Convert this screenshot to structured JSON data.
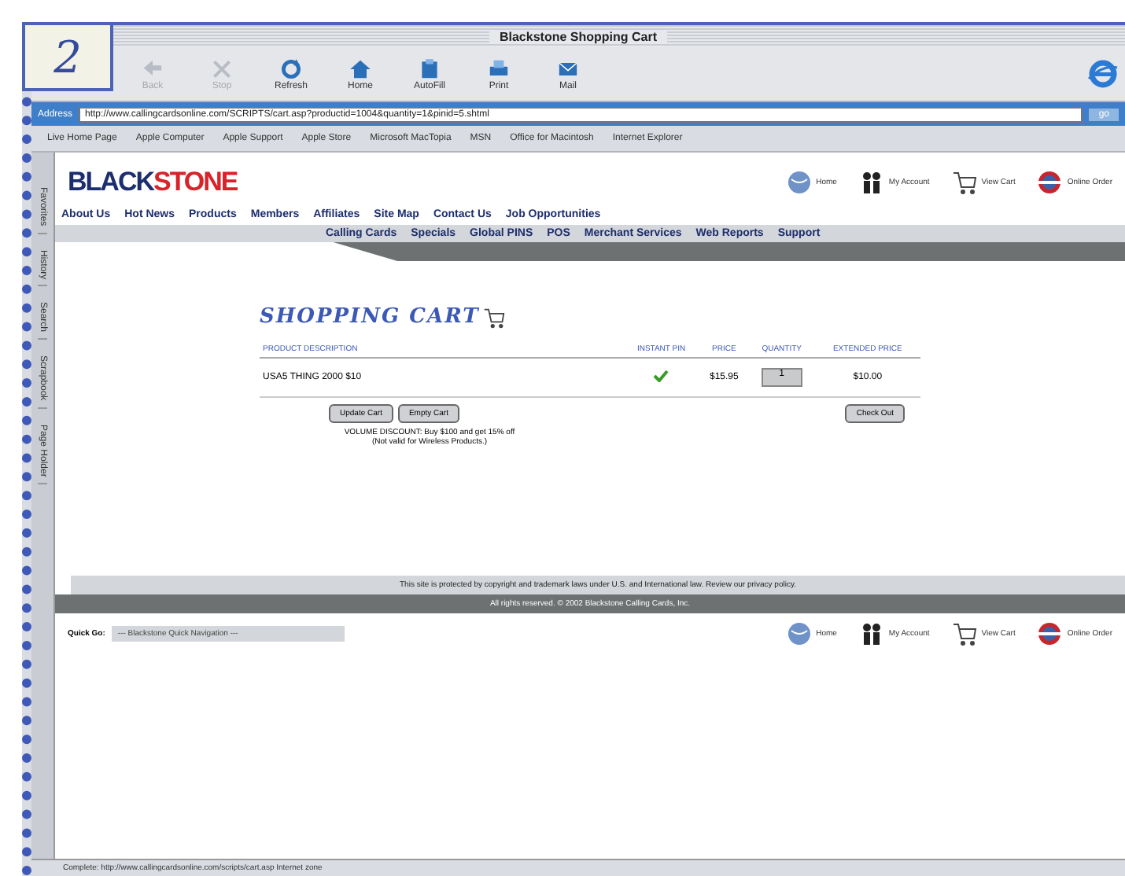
{
  "step_number": "2",
  "window": {
    "title": "Blackstone Shopping Cart"
  },
  "toolbar": [
    {
      "label": "Back",
      "disabled": true
    },
    {
      "label": "Stop",
      "disabled": true
    },
    {
      "label": "Refresh",
      "disabled": false
    },
    {
      "label": "Home",
      "disabled": false
    },
    {
      "label": "AutoFill",
      "disabled": false
    },
    {
      "label": "Print",
      "disabled": false
    },
    {
      "label": "Mail",
      "disabled": false
    }
  ],
  "address_bar": {
    "label": "Address",
    "value": "http://www.callingcardsonline.com/SCRIPTS/cart.asp?productid=1004&quantity=1&pinid=5.shtml",
    "go": "go"
  },
  "favorites_bar": [
    "Live Home Page",
    "Apple Computer",
    "Apple Support",
    "Apple Store",
    "Microsoft MacTopia",
    "MSN",
    "Office for Macintosh",
    "Internet Explorer"
  ],
  "side_tabs": [
    "Favorites",
    "History",
    "Search",
    "Scrapbook",
    "Page Holder"
  ],
  "site": {
    "logo_left": "BLACK",
    "logo_right": "STONE",
    "top_links": [
      "Home",
      "My Account",
      "View Cart",
      "Online Order"
    ],
    "main_nav": [
      "About Us",
      "Hot News",
      "Products",
      "Members",
      "Affiliates",
      "Site Map",
      "Contact Us",
      "Job Opportunities"
    ],
    "sub_nav": [
      "Calling Cards",
      "Specials",
      "Global PINS",
      "POS",
      "Merchant Services",
      "Web Reports",
      "Support"
    ]
  },
  "cart": {
    "title": "SHOPPING CART",
    "columns": [
      "PRODUCT DESCRIPTION",
      "INSTANT PIN",
      "PRICE",
      "QUANTITY",
      "EXTENDED PRICE"
    ],
    "rows": [
      {
        "description": "USA5 THING 2000 $10",
        "instant_pin": true,
        "price": "$15.95",
        "quantity": "1",
        "extended_price": "$10.00"
      }
    ],
    "buttons": [
      "Update Cart",
      "Empty Cart"
    ],
    "checkout": "Check Out",
    "discount": "VOLUME DISCOUNT: Buy $100 and get 15% off",
    "discount_note": "(Not valid for Wireless Products.)"
  },
  "footer": {
    "notice": "This site is protected by copyright and trademark laws under U.S. and International law. Review our privacy policy.",
    "copyright": "All rights reserved. © 2002 Blackstone Calling Cards, Inc.",
    "quick_go_label": "Quick Go:",
    "quick_go_value": "--- Blackstone Quick Navigation ---",
    "bottom_links": [
      "Home",
      "My Account",
      "View Cart",
      "Online Order"
    ]
  },
  "status_bar": "Complete: http://www.callingcardsonline.com/scripts/cart.asp  Internet zone"
}
